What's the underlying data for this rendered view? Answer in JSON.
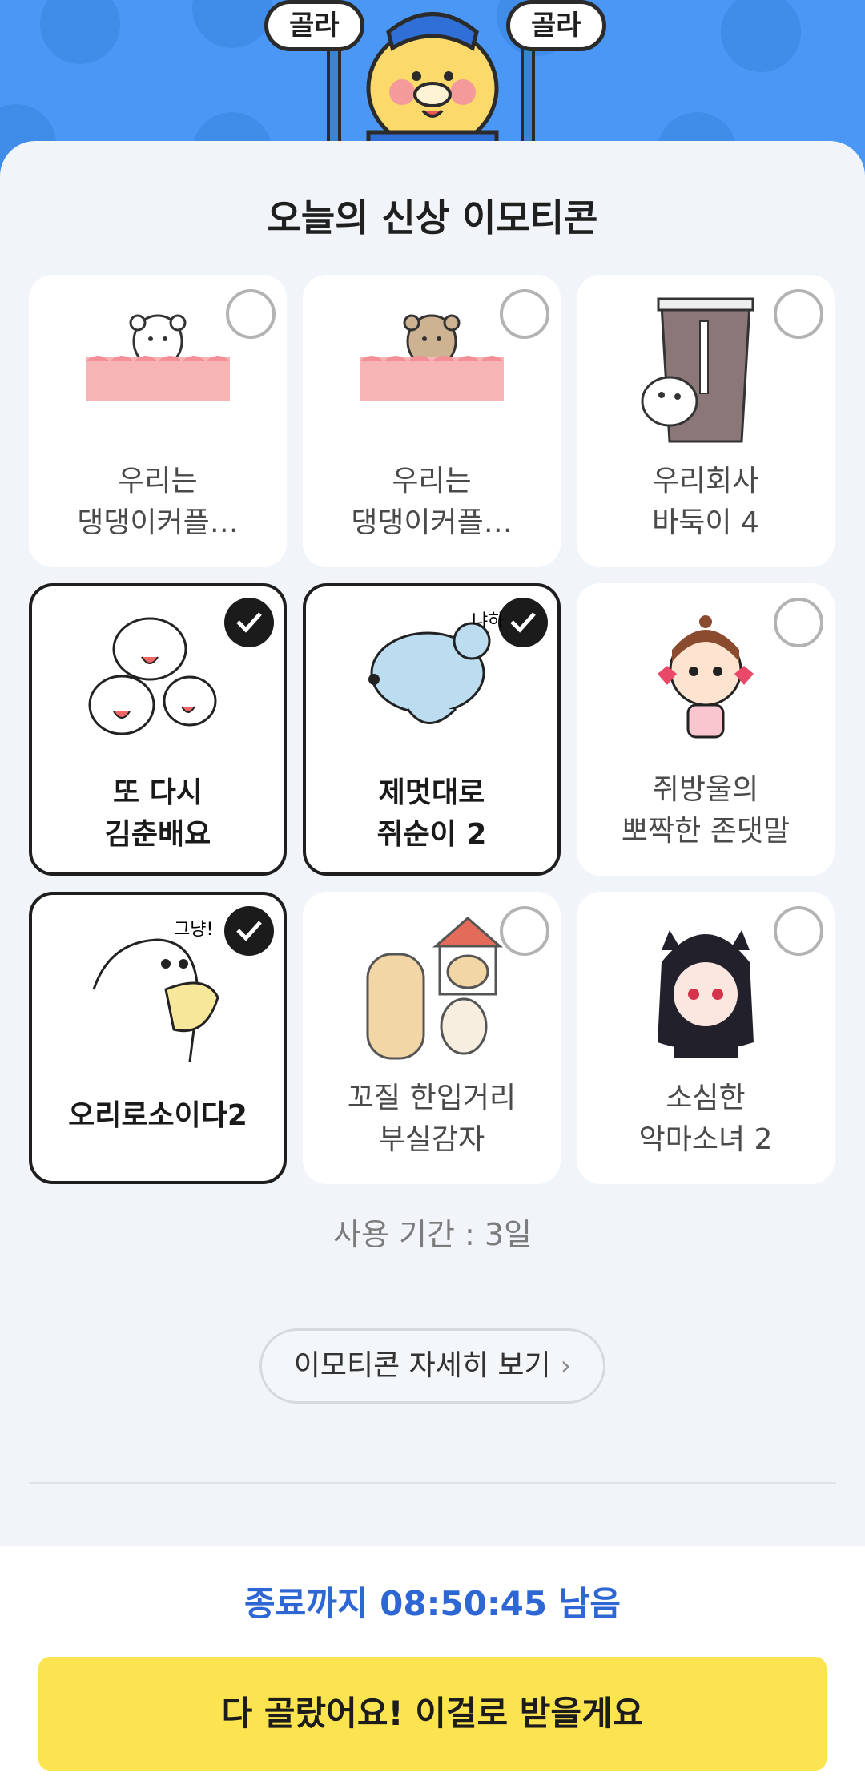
{
  "hero": {
    "bubble_left": "골라",
    "bubble_right": "골라"
  },
  "title": "오늘의 신상 이모티콘",
  "cards": [
    {
      "line1": "우리는",
      "line2": "댕댕이커플…",
      "selected": false,
      "icon": "white-puppy-in-hearts"
    },
    {
      "line1": "우리는",
      "line2": "댕댕이커플…",
      "selected": false,
      "icon": "brown-puppy-in-hearts"
    },
    {
      "line1": "우리회사",
      "line2": "바둑이 4",
      "selected": false,
      "icon": "dog-with-drink-cup"
    },
    {
      "line1": "또 다시",
      "line2": "김춘배요",
      "selected": true,
      "icon": "white-cats-group"
    },
    {
      "line1": "제멋대로",
      "line2": "쥐순이 2",
      "selected": true,
      "icon": "blue-mouse",
      "sticker_text": "냐하"
    },
    {
      "line1": "쥐방울의",
      "line2": "뽀짝한 존댓말",
      "selected": false,
      "icon": "girl-with-hearts"
    },
    {
      "line1": "오리로소이다2",
      "line2": "",
      "selected": true,
      "icon": "white-duck",
      "sticker_text": "그냥!"
    },
    {
      "line1": "꼬질 한입거리",
      "line2": "부실감자",
      "selected": false,
      "icon": "potato-characters"
    },
    {
      "line1": "소심한",
      "line2": "악마소녀 2",
      "selected": false,
      "icon": "devil-girl"
    }
  ],
  "period_text": "사용 기간 : 3일",
  "detail_button": "이모티콘 자세히 보기",
  "timer_text": "종료까지 08:50:45 남음",
  "cta_label": "다 골랐어요! 이걸로 받을게요",
  "colors": {
    "hero_blue": "#4b97f6",
    "accent_blue": "#2e67d4",
    "cta_yellow": "#fbe44f"
  }
}
